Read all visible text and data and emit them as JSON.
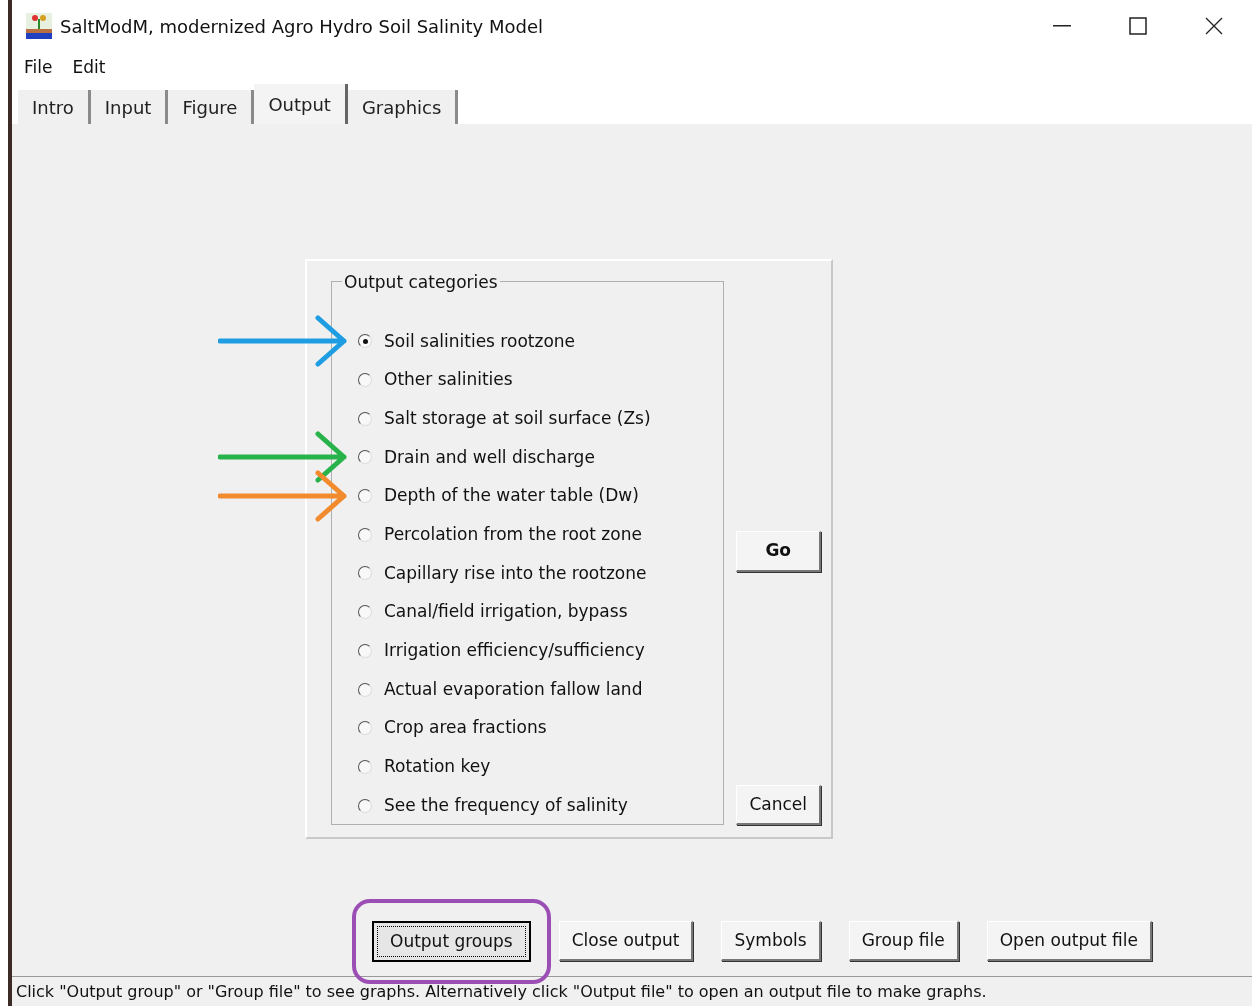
{
  "window": {
    "title": "SaltModM, modernized Agro Hydro Soil Salinity Model"
  },
  "menu": [
    "File",
    "Edit"
  ],
  "tabs": [
    {
      "label": "Intro",
      "selected": false
    },
    {
      "label": "Input",
      "selected": false
    },
    {
      "label": "Figure",
      "selected": false
    },
    {
      "label": "Output",
      "selected": true
    },
    {
      "label": "Graphics",
      "selected": false
    }
  ],
  "output_categories": {
    "title": "Output categories",
    "options": [
      {
        "label": "Soil salinities rootzone",
        "selected": true,
        "arrow": {
          "color": "#1e9de3"
        }
      },
      {
        "label": "Other salinities",
        "selected": false
      },
      {
        "label": "Salt storage at soil surface (Zs)",
        "selected": false
      },
      {
        "label": "Drain and well discharge",
        "selected": false,
        "arrow": {
          "color": "#27b24a"
        }
      },
      {
        "label": "Depth of the water table (Dw)",
        "selected": false,
        "arrow": {
          "color": "#f28a2e"
        }
      },
      {
        "label": "Percolation from the root zone",
        "selected": false
      },
      {
        "label": "Capillary rise into the rootzone",
        "selected": false
      },
      {
        "label": "Canal/field irrigation, bypass",
        "selected": false
      },
      {
        "label": "Irrigation efficiency/sufficiency",
        "selected": false
      },
      {
        "label": "Actual evaporation fallow land",
        "selected": false
      },
      {
        "label": "Crop area fractions",
        "selected": false
      },
      {
        "label": "Rotation key",
        "selected": false
      },
      {
        "label": "See the frequency of salinity",
        "selected": false
      }
    ],
    "go_button": "Go",
    "cancel_button": "Cancel"
  },
  "buttons": [
    {
      "label": "Output groups",
      "focused": true,
      "highlight": {
        "color": "#9b4fb5"
      }
    },
    {
      "label": "Close output",
      "focused": false
    },
    {
      "label": "Symbols",
      "focused": false
    },
    {
      "label": "Group file",
      "focused": false
    },
    {
      "label": "Open output file",
      "focused": false
    }
  ],
  "status_bar": "Click \"Output group\" or \"Group file\" to see graphs. Alternatively click \"Output file\" to open an output file to make graphs."
}
